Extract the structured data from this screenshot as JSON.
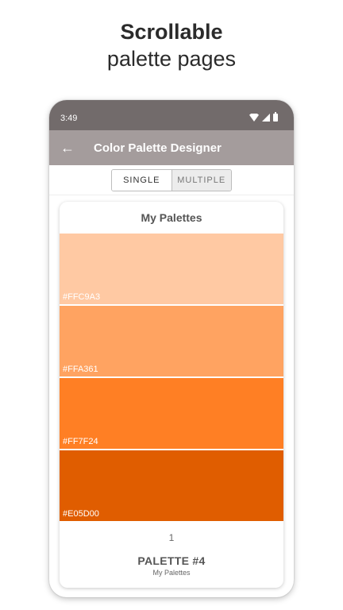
{
  "promo": {
    "title": "Scrollable",
    "subtitle": "palette pages"
  },
  "status_bar": {
    "time": "3:49",
    "icons": [
      "wifi-icon",
      "signal-icon",
      "battery-icon"
    ]
  },
  "app_bar": {
    "back_icon": "arrow-left-icon",
    "title": "Color Palette Designer"
  },
  "mode_toggle": {
    "single_label": "SINGLE",
    "multiple_label": "MULTIPLE",
    "selected": "MULTIPLE"
  },
  "palette_card": {
    "title": "My Palettes",
    "swatches": [
      {
        "label": "#FFC9A3",
        "color": "#FFC9A3"
      },
      {
        "label": "#FFA361",
        "color": "#FFA361"
      },
      {
        "label": "#FF7F24",
        "color": "#FF7F24"
      },
      {
        "label": "#E05D00",
        "color": "#E05D00"
      }
    ],
    "page_number": "1",
    "palette_name": "PALETTE #4",
    "palette_subtitle": "My Palettes"
  },
  "colors": {
    "status_bar": "#726b6b",
    "app_bar": "#a49c9c"
  }
}
